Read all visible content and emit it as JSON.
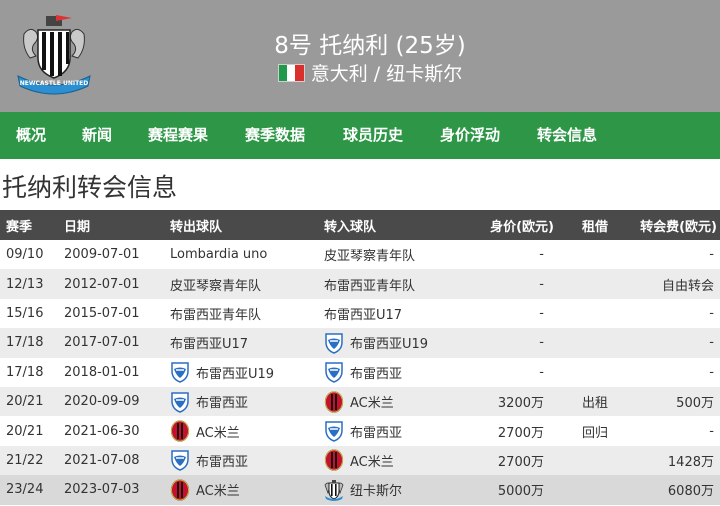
{
  "header": {
    "player_name": "8号 托纳利 (25岁)",
    "player_sub": "意大利 / 纽卡斯尔",
    "club_logo_icon": "newcastle-united-crest-icon",
    "club_logo_text": "NEWCASTLE UNITED",
    "flag_icon": "italy-flag-icon"
  },
  "nav": {
    "items": [
      "概况",
      "新闻",
      "赛程赛果",
      "赛季数据",
      "球员历史",
      "身价浮动",
      "转会信息"
    ]
  },
  "page": {
    "title": "托纳利转会信息"
  },
  "table": {
    "headers": {
      "season": "赛季",
      "date": "日期",
      "from": "转出球队",
      "to": "转入球队",
      "value": "身价(欧元)",
      "loan": "租借",
      "fee": "转会费(欧元)"
    },
    "rows": [
      {
        "season": "09/10",
        "date": "2009-07-01",
        "from": "Lombardia uno",
        "to": "皮亚琴察青年队",
        "value": "-",
        "loan": "",
        "fee": "-"
      },
      {
        "season": "12/13",
        "date": "2012-07-01",
        "from": "皮亚琴察青年队",
        "to": "布雷西亚青年队",
        "value": "-",
        "loan": "",
        "fee": "自由转会"
      },
      {
        "season": "15/16",
        "date": "2015-07-01",
        "from": "布雷西亚青年队",
        "to": "布雷西亚U17",
        "value": "-",
        "loan": "",
        "fee": "-"
      },
      {
        "season": "17/18",
        "date": "2017-07-01",
        "from": "布雷西亚U17",
        "to": "布雷西亚U19",
        "value": "-",
        "loan": "",
        "fee": "-"
      },
      {
        "season": "17/18",
        "date": "2018-01-01",
        "from": "布雷西亚U19",
        "to": "布雷西亚",
        "value": "-",
        "loan": "",
        "fee": "-"
      },
      {
        "season": "20/21",
        "date": "2020-09-09",
        "from": "布雷西亚",
        "to": "AC米兰",
        "value": "3200万",
        "loan": "出租",
        "fee": "500万"
      },
      {
        "season": "20/21",
        "date": "2021-06-30",
        "from": "AC米兰",
        "to": "布雷西亚",
        "value": "2700万",
        "loan": "回归",
        "fee": "-"
      },
      {
        "season": "21/22",
        "date": "2021-07-08",
        "from": "布雷西亚",
        "to": "AC米兰",
        "value": "2700万",
        "loan": "",
        "fee": "1428万"
      },
      {
        "season": "23/24",
        "date": "2023-07-03",
        "from": "AC米兰",
        "to": "纽卡斯尔",
        "value": "5000万",
        "loan": "",
        "fee": "6080万"
      }
    ]
  },
  "colors": {
    "header_bg": "#9a9a9a",
    "nav_bg": "#2d9647",
    "table_header_bg": "#4a4a4a",
    "row_alt_bg": "#ececec",
    "row_highlight_bg": "#d9d9d9"
  }
}
